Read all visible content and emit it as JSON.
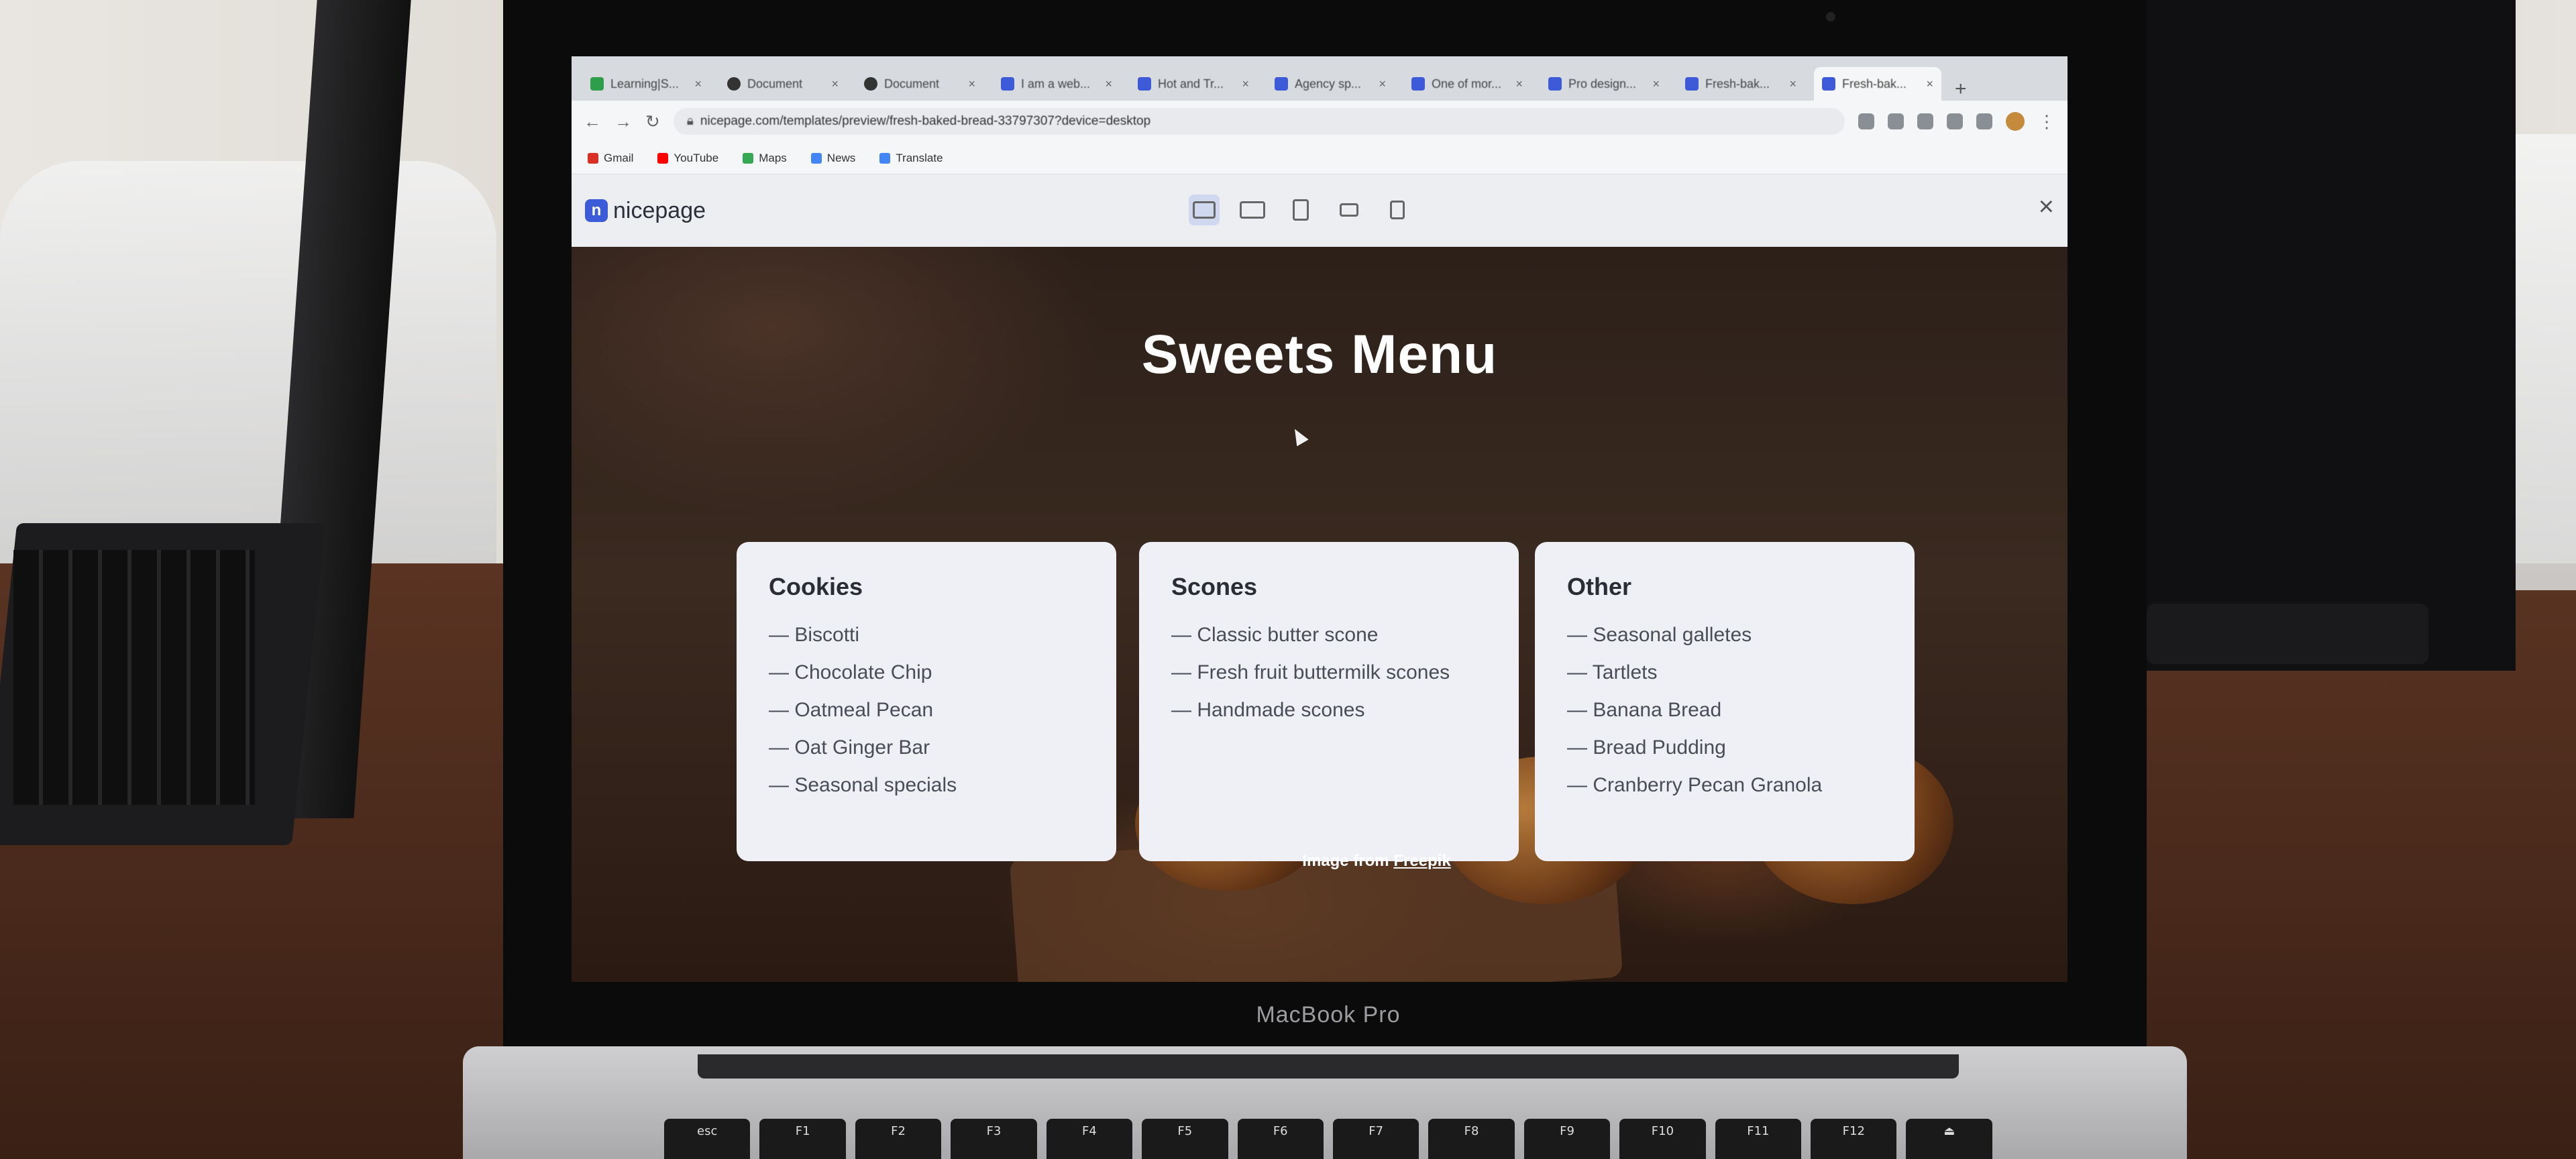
{
  "browser": {
    "tabs": [
      {
        "label": "Learning|S...",
        "icon": "learning-icon"
      },
      {
        "label": "Document",
        "icon": "github-icon"
      },
      {
        "label": "Document",
        "icon": "github-icon"
      },
      {
        "label": "I am a web...",
        "icon": "nicepage-icon"
      },
      {
        "label": "Hot and Tr...",
        "icon": "nicepage-icon"
      },
      {
        "label": "Agency sp...",
        "icon": "nicepage-icon"
      },
      {
        "label": "One of mor...",
        "icon": "nicepage-icon"
      },
      {
        "label": "Pro design...",
        "icon": "nicepage-icon"
      },
      {
        "label": "Fresh-bak...",
        "icon": "nicepage-icon"
      },
      {
        "label": "Fresh-bak...",
        "icon": "nicepage-icon",
        "active": true
      }
    ],
    "new_tab": "+",
    "url": "nicepage.com/templates/preview/fresh-baked-bread-33797307?device=desktop",
    "bookmarks": [
      {
        "label": "Gmail",
        "color": "#d93025"
      },
      {
        "label": "YouTube",
        "color": "#ff0000"
      },
      {
        "label": "Maps",
        "color": "#34a853"
      },
      {
        "label": "News",
        "color": "#4285f4"
      },
      {
        "label": "Translate",
        "color": "#4285f4"
      }
    ]
  },
  "preview_bar": {
    "logo_text": "nicepage",
    "logo_mark": "n",
    "devices": [
      "desktop",
      "laptop",
      "tablet",
      "tablet-landscape",
      "phone"
    ],
    "active_device": "desktop",
    "close": "×"
  },
  "hero": {
    "title": "Sweets Menu",
    "cards": [
      {
        "heading": "Cookies",
        "items": [
          "— Biscotti",
          "— Chocolate Chip",
          "— Oatmeal Pecan",
          "— Oat Ginger Bar",
          "— Seasonal specials"
        ]
      },
      {
        "heading": "Scones",
        "items": [
          "— Classic butter scone",
          "— Fresh fruit buttermilk scones",
          "— Handmade scones"
        ]
      },
      {
        "heading": "Other",
        "items": [
          "— Seasonal galletes",
          "— Tartlets",
          "— Banana Bread",
          "— Bread Pudding",
          "— Cranberry Pecan Granola"
        ]
      }
    ],
    "credit_prefix": "Image from",
    "credit_link": "Freepik"
  },
  "device": {
    "label": "MacBook Pro",
    "keys": [
      "esc",
      "F1",
      "F2",
      "F3",
      "F4",
      "F5",
      "F6",
      "F7",
      "F8",
      "F9",
      "F10",
      "F11",
      "F12",
      "⏏"
    ]
  },
  "colors": {
    "accent": "#3b5bd9",
    "card_bg": "#eef0f6"
  }
}
